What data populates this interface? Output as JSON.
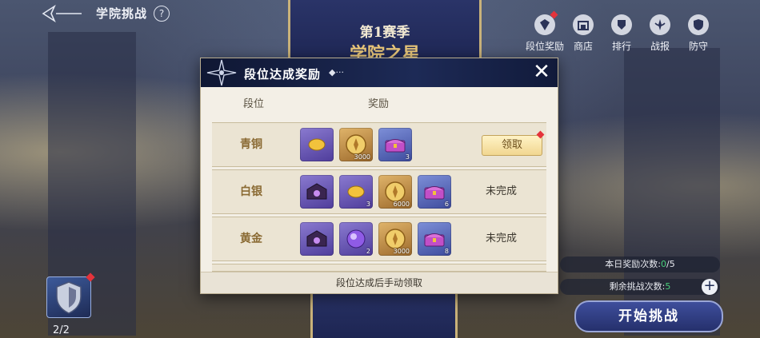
{
  "header": {
    "title": "学院挑战",
    "help_label": "?"
  },
  "banner": {
    "season": "第1赛季",
    "name": "学院之星"
  },
  "topnav": [
    {
      "id": "rank-reward",
      "label": "段位奖励",
      "icon": "rank-badge-icon",
      "badge": true
    },
    {
      "id": "shop",
      "label": "商店",
      "icon": "shop-icon",
      "badge": false
    },
    {
      "id": "leaderboard",
      "label": "排行",
      "icon": "leaderboard-icon",
      "badge": false
    },
    {
      "id": "battle-report",
      "label": "战报",
      "icon": "battle-report-icon",
      "badge": false
    },
    {
      "id": "defense",
      "label": "防守",
      "icon": "shield-icon",
      "badge": false
    }
  ],
  "modal": {
    "title": "段位达成奖励",
    "title_deco": "◆···",
    "close_label": "✕",
    "col_rank": "段位",
    "col_reward": "奖励",
    "footer": "段位达成后手动领取",
    "rows": [
      {
        "rank": "青铜",
        "action": "领取",
        "status": "",
        "claimable": true,
        "items": [
          {
            "type": "gold-bean",
            "quality": "purple",
            "count": ""
          },
          {
            "type": "gold-coin",
            "quality": "gold",
            "count": "3000"
          },
          {
            "type": "treasure-chest",
            "quality": "blue",
            "count": "3"
          }
        ]
      },
      {
        "rank": "白银",
        "action": "",
        "status": "未完成",
        "claimable": false,
        "items": [
          {
            "type": "dark-chest",
            "quality": "purple",
            "count": ""
          },
          {
            "type": "gold-bean",
            "quality": "purple",
            "count": "3"
          },
          {
            "type": "gold-coin",
            "quality": "gold",
            "count": "6000"
          },
          {
            "type": "treasure-chest",
            "quality": "blue",
            "count": "6"
          }
        ]
      },
      {
        "rank": "黄金",
        "action": "",
        "status": "未完成",
        "claimable": false,
        "items": [
          {
            "type": "dark-chest",
            "quality": "purple",
            "count": ""
          },
          {
            "type": "magic-orb",
            "quality": "purple",
            "count": "2"
          },
          {
            "type": "gold-coin",
            "quality": "gold",
            "count": "3000"
          },
          {
            "type": "treasure-chest",
            "quality": "blue",
            "count": "8"
          }
        ]
      }
    ]
  },
  "card": {
    "count": "2/2"
  },
  "daily": {
    "label": "本日奖励次数:",
    "current": "0",
    "max": "/5"
  },
  "remaining": {
    "label": "剩余挑战次数:",
    "value": "5"
  },
  "start_button": "开始挑战",
  "colors": {
    "accent": "#25306c",
    "gold": "#c3a35b",
    "badge": "#e4333b",
    "green": "#49d07b"
  }
}
